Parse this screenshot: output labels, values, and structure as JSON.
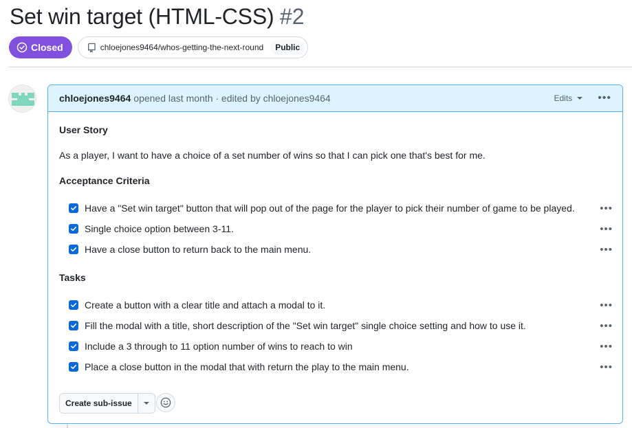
{
  "issue": {
    "title": "Set win target (HTML-CSS)",
    "number": "#2",
    "state": "Closed",
    "state_color": "#8250df",
    "repo": "chloejones9464/whos-getting-the-next-round",
    "visibility": "Public"
  },
  "comment": {
    "author": "chloejones9464",
    "header_text": "opened last month · edited by chloejones9464",
    "edits_label": "Edits",
    "more_icon": "kebab-horizontal-icon",
    "sections": {
      "user_story_heading": "User Story",
      "user_story_text": "As a player, I want to have a choice of a set number of wins so that I can pick one that's best for me.",
      "acceptance_heading": "Acceptance Criteria",
      "acceptance_items": [
        {
          "label": "Have a \"Set win target\" button that will pop out of the page for the player to pick their number of game to be played.",
          "checked": true
        },
        {
          "label": "Single choice option between 3-11.",
          "checked": true
        },
        {
          "label": "Have a close button to return back to the main menu.",
          "checked": true
        }
      ],
      "tasks_heading": "Tasks",
      "task_items": [
        {
          "label": "Create a button with a clear title and attach a modal to it.",
          "checked": true
        },
        {
          "label": "Fill the modal with a title, short description of the \"Set win target\" single choice setting and how to use it.",
          "checked": true
        },
        {
          "label": "Include a 3 through to 11 option number of wins to reach to win",
          "checked": true
        },
        {
          "label": "Place a close button in the modal that with return the play to the main menu.",
          "checked": true
        }
      ]
    },
    "create_subissue_label": "Create sub-issue",
    "reaction_icon": "smiley-icon"
  }
}
